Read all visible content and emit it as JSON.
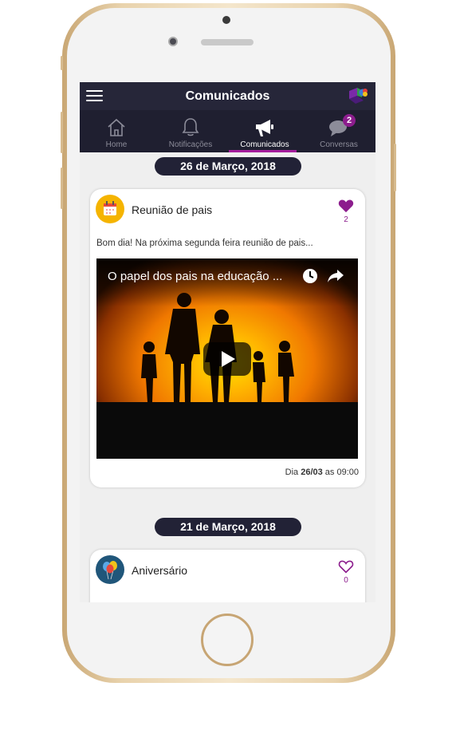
{
  "header": {
    "title": "Comunicados"
  },
  "tabs": [
    {
      "label": "Home",
      "icon": "home-icon",
      "active": false
    },
    {
      "label": "Notificações",
      "icon": "bell-icon",
      "active": false
    },
    {
      "label": "Comunicados",
      "icon": "megaphone-icon",
      "active": true
    },
    {
      "label": "Conversas",
      "icon": "chat-icon",
      "active": false,
      "badge": "2"
    }
  ],
  "feed": [
    {
      "date": "26 de Março, 2018",
      "title": "Reunião de pais",
      "icon": "calendar-icon",
      "liked": true,
      "likes": "2",
      "text": "Bom dia! Na próxima segunda feira reunião de pais...",
      "video_title": "O papel dos pais na educação ...",
      "time_prefix": "Dia",
      "time_date": "26/03",
      "time_suffix": "as 09:00"
    },
    {
      "date": "21 de Março, 2018",
      "title": "Aniversário",
      "icon": "balloons-icon",
      "liked": false,
      "likes": "0"
    }
  ],
  "colors": {
    "header_bg": "#262639",
    "tabbar_bg": "#1f1f30",
    "accent": "#8c1d8d",
    "date_pill": "#222236",
    "phone_gold": "#e9d3ad"
  }
}
